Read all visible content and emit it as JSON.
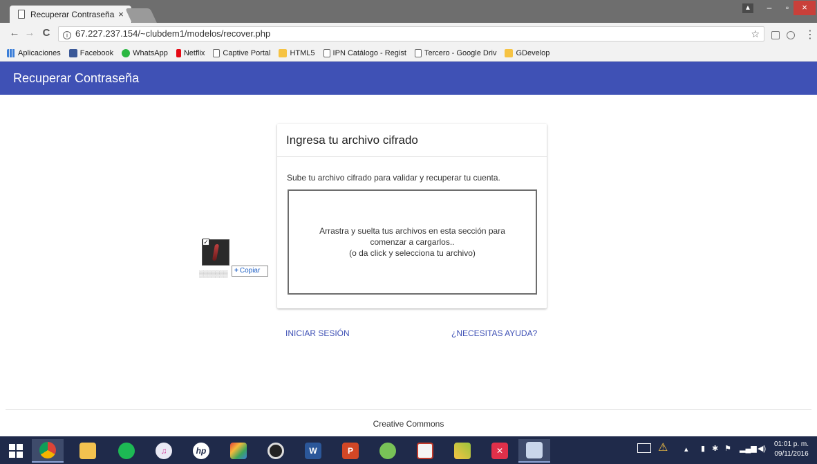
{
  "browser": {
    "tab_title": "Recuperar Contraseña",
    "tab_close": "×",
    "url": "67.227.237.154/~clubdem1/modelos/recover.php",
    "back_glyph": "←",
    "forward_glyph": "→",
    "reload_glyph": "C",
    "info_glyph": "i",
    "star_glyph": "☆",
    "menu_glyph": "⋮",
    "window_min": "–",
    "window_max": "▫",
    "window_close": "×",
    "bookmarks": [
      {
        "label": "Aplicaciones",
        "icon": "apps"
      },
      {
        "label": "Facebook",
        "icon": "fb"
      },
      {
        "label": "WhatsApp",
        "icon": "wa"
      },
      {
        "label": "Netflix",
        "icon": "nf"
      },
      {
        "label": "Captive Portal",
        "icon": "page"
      },
      {
        "label": "HTML5",
        "icon": "folder"
      },
      {
        "label": "IPN Catálogo - Regist",
        "icon": "page"
      },
      {
        "label": "Tercero - Google Driv",
        "icon": "page"
      },
      {
        "label": "GDevelop",
        "icon": "folder"
      }
    ]
  },
  "header": {
    "title": "Recuperar Contraseña",
    "color": "#3f51b5"
  },
  "card": {
    "title": "Ingresa tu archivo cifrado",
    "description": "Sube tu archivo cifrado para validar y recuperar tu cuenta.",
    "dropzone_line1": "Arrastra y suelta tus archivos en esta sección para comenzar a cargarlos..",
    "dropzone_line2": "(o da click y selecciona tu archivo)"
  },
  "links": {
    "login": "INICIAR SESIÓN",
    "help": "¿NECESITAS AYUDA?"
  },
  "drag": {
    "check": "✓",
    "copy_plus": "+",
    "copy_label": "Copiar"
  },
  "footer": {
    "text": "Creative Commons"
  },
  "taskbar": {
    "apps": [
      "start-icon",
      "chrome-icon",
      "file-explorer-icon",
      "spotify-icon",
      "itunes-icon",
      "hp-icon",
      "app-icon",
      "webcam-icon",
      "word-icon",
      "powerpoint-icon",
      "android-studio-icon",
      "paint-icon",
      "tool-icon",
      "xmind-icon",
      "snipping-tool-icon"
    ],
    "word_letter": "W",
    "ppt_letter": "P",
    "hp_letters": "hp",
    "time": "01:01 p. m.",
    "date": "09/11/2016"
  }
}
